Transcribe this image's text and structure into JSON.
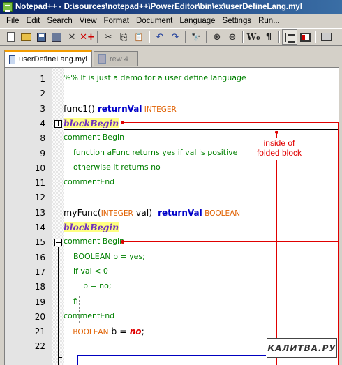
{
  "window": {
    "title": "Notepad++ - D:\\sources\\notepad++\\PowerEditor\\bin\\ex\\userDefineLang.myl"
  },
  "menu": [
    "File",
    "Edit",
    "Search",
    "View",
    "Format",
    "Document",
    "Language",
    "Settings",
    "Run..."
  ],
  "toolbar": {
    "close_glyph": "✕",
    "closeall_glyph": "✕+",
    "cut_glyph": "✂",
    "copy_glyph": "⎘",
    "paste_glyph": "📋",
    "undo_glyph": "↶",
    "redo_glyph": "↷",
    "find_glyph": "🔭",
    "zoomin_glyph": "⊕",
    "zoomout_glyph": "⊖",
    "wrap_label": "W₀",
    "pilcrow_glyph": "¶"
  },
  "tabs": [
    {
      "label": "userDefineLang.myl",
      "active": true
    },
    {
      "label": "rew 4",
      "active": false
    }
  ],
  "editor": {
    "lines": [
      {
        "num": "1",
        "tokens": [
          {
            "t": "%% It is just a demo for a user define language",
            "c": "c-comment"
          }
        ]
      },
      {
        "num": "2",
        "tokens": []
      },
      {
        "num": "3",
        "tokens": [
          {
            "t": "func1() ",
            "c": "c-plain c-big"
          },
          {
            "t": "returnVal",
            "c": "c-kw"
          },
          {
            "t": " INTEGER",
            "c": "c-type"
          }
        ]
      },
      {
        "num": "4",
        "tokens": [
          {
            "t": "blockBegin",
            "c": "c-block"
          }
        ]
      },
      {
        "num": "8",
        "tokens": [
          {
            "t": "comment Begin",
            "c": "c-comment"
          }
        ]
      },
      {
        "num": "9",
        "tokens": [
          {
            "t": "    function aFunc returns yes if val is positive",
            "c": "c-comment"
          }
        ]
      },
      {
        "num": "10",
        "tokens": [
          {
            "t": "    otherwise it returns no",
            "c": "c-comment"
          }
        ]
      },
      {
        "num": "11",
        "tokens": [
          {
            "t": "commentEnd",
            "c": "c-comment"
          }
        ]
      },
      {
        "num": "12",
        "tokens": []
      },
      {
        "num": "13",
        "tokens": [
          {
            "t": "myFunc(",
            "c": "c-plain c-big"
          },
          {
            "t": "INTEGER",
            "c": "c-type"
          },
          {
            "t": " val)  ",
            "c": "c-plain c-big"
          },
          {
            "t": "returnVal",
            "c": "c-kw"
          },
          {
            "t": " BOOLEAN",
            "c": "c-type"
          }
        ]
      },
      {
        "num": "14",
        "tokens": [
          {
            "t": "blockBegin",
            "c": "c-block"
          }
        ]
      },
      {
        "num": "15",
        "tokens": [
          {
            "t": "comment Begin",
            "c": "c-comment"
          }
        ]
      },
      {
        "num": "16",
        "tokens": [
          {
            "t": "    BOOLEAN b = yes;",
            "c": "c-comment"
          }
        ]
      },
      {
        "num": "17",
        "tokens": [
          {
            "t": "    if val < 0",
            "c": "c-comment"
          }
        ]
      },
      {
        "num": "18",
        "tokens": [
          {
            "t": "        b = no;",
            "c": "c-comment"
          }
        ]
      },
      {
        "num": "19",
        "tokens": [
          {
            "t": "    fi",
            "c": "c-comment"
          }
        ]
      },
      {
        "num": "20",
        "tokens": [
          {
            "t": "commentEnd",
            "c": "c-comment"
          }
        ]
      },
      {
        "num": "21",
        "tokens": [
          {
            "t": "    BOOLEAN",
            "c": "c-type"
          },
          {
            "t": " b = ",
            "c": "c-plain c-big"
          },
          {
            "t": "no",
            "c": "c-italic-red"
          },
          {
            "t": ";",
            "c": "c-plain c-big"
          }
        ]
      },
      {
        "num": "22",
        "tokens": []
      }
    ]
  },
  "annotation": {
    "text": "inside of\nfolded block"
  },
  "watermark": {
    "text": "КАЛИТВА.РУ"
  },
  "colors": {
    "annotation": "#e00000",
    "block_highlight": "#ffff80",
    "keyword": "#0000c8",
    "type": "#e06000",
    "comment": "#008000"
  }
}
